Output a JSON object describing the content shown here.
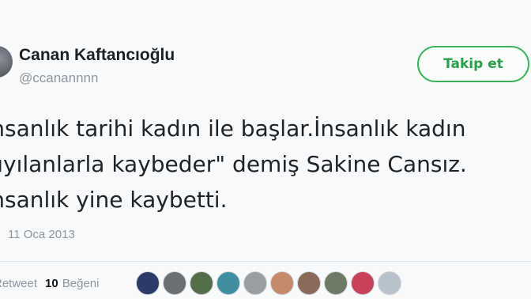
{
  "tweet": {
    "author_name": "Canan Kaftancıoğlu",
    "author_handle": "@ccanannnn",
    "follow_label": "Takip et",
    "text_lines": [
      "İnsanlık tarihi kadın ile başlar.İnsanlık kadın",
      "kıyılanlarla kaybeder\" demiş Sakine Cansız.",
      "İnsanlık yine kaybetti."
    ],
    "timestamp": "11 Oca 2013",
    "retweet_label": "Retweet",
    "likes_count": "10",
    "likes_label": "Beğeni"
  },
  "likers": [
    {
      "name": "liker-avatar-1",
      "color": "#2b3a66"
    },
    {
      "name": "liker-avatar-2",
      "color": "#6b6f73"
    },
    {
      "name": "liker-avatar-3",
      "color": "#556e4a"
    },
    {
      "name": "liker-avatar-4",
      "color": "#3f8fa0"
    },
    {
      "name": "liker-avatar-5",
      "color": "#9a9ea3"
    },
    {
      "name": "liker-avatar-6",
      "color": "#c48a6b"
    },
    {
      "name": "liker-avatar-7",
      "color": "#8a6a5a"
    },
    {
      "name": "liker-avatar-8",
      "color": "#6d7a66"
    },
    {
      "name": "liker-avatar-9",
      "color": "#c9405a"
    },
    {
      "name": "liker-avatar-10",
      "color": "#b8c2cc"
    }
  ],
  "colors": {
    "follow_border": "#3cb45a",
    "follow_text": "#27a048",
    "secondary_text": "#8d98a2"
  }
}
